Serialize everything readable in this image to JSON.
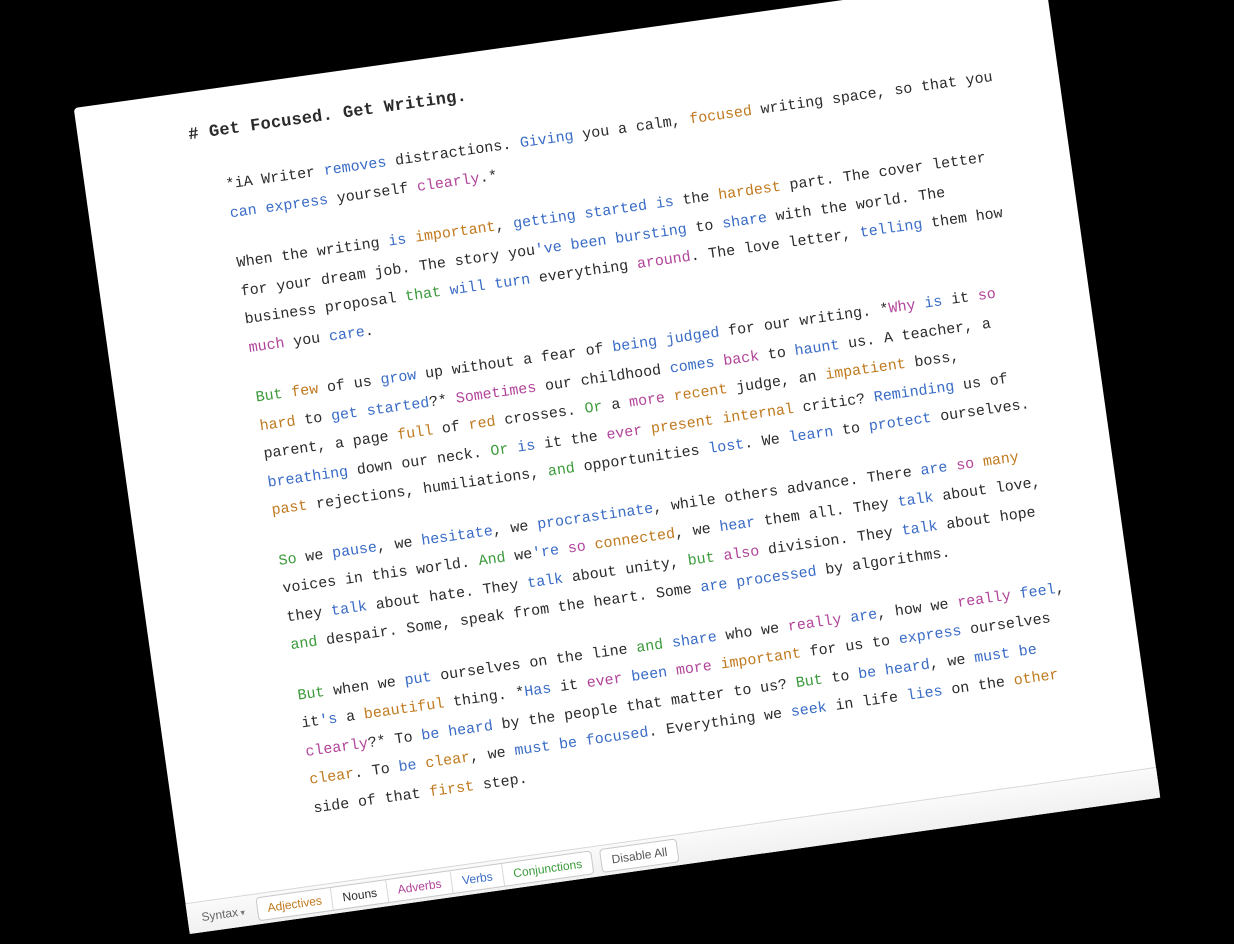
{
  "document": {
    "heading": "# Get Focused. Get Writing.",
    "p1": {
      "t1": "*iA Writer ",
      "removes": "removes",
      "t2": " distractions. ",
      "giving": "Giving",
      "t3": " you a calm, ",
      "focused": "focused",
      "t4": " writing space, so that you ",
      "can": "can",
      "t5": " ",
      "express": "express",
      "t6": " yourself ",
      "clearly": "clearly",
      "t7": ".*"
    },
    "p2": {
      "t1": "When the writing ",
      "is1": "is",
      "t2": " ",
      "important": "important",
      "t3": ", ",
      "getting": "getting",
      "t4": " ",
      "started": "started",
      "t5": " ",
      "is2": "is",
      "t6": " the ",
      "hardest": "hardest",
      "t7": " part. The cover letter for your dream job. The story you",
      "ve": "'ve",
      "t8": " ",
      "been": "been",
      "t9": " ",
      "bursting": "bursting",
      "t10": " to ",
      "share": "share",
      "t11": " with the world. The business proposal ",
      "that": "that",
      "t12": " ",
      "will": "will",
      "t13": " ",
      "turn": "turn",
      "t14": " everything ",
      "around": "around",
      "t15": ". The love letter, ",
      "telling": "telling",
      "t16": " them how ",
      "much": "much",
      "t17": " you ",
      "care": "care",
      "t18": "."
    },
    "p3": {
      "but1": "But",
      "t1": " ",
      "few": "few",
      "t2": " of us ",
      "grow": "grow",
      "t3": " up without a fear of ",
      "being": "being",
      "t4": " ",
      "judged": "judged",
      "t5": " for our writing. *",
      "why": "Why",
      "t6": " ",
      "is1": "is",
      "t7": " it ",
      "so": "so",
      "t8": " ",
      "hard": "hard",
      "t9": " to ",
      "get": "get",
      "t10": " ",
      "started": "started",
      "t11": "?* ",
      "sometimes": "Sometimes",
      "t12": " our childhood ",
      "comes": "comes",
      "t13": " ",
      "back": "back",
      "t14": " to ",
      "haunt": "haunt",
      "t15": " us. A teacher, a parent, a page ",
      "full": "full",
      "t16": " of ",
      "red": "red",
      "t17": " crosses. ",
      "or1": "Or",
      "t18": " a ",
      "more": "more",
      "t19": " ",
      "recent": "recent",
      "t20": " judge, an ",
      "impatient": "impatient",
      "t21": " boss, ",
      "breathing": "breathing",
      "t22": " down our neck. ",
      "or2": "Or",
      "t23": " ",
      "is2": "is",
      "t24": " it the ",
      "ever": "ever",
      "t25": " ",
      "present": "present",
      "t26": " ",
      "internal": "internal",
      "t27": " critic? ",
      "reminding": "Reminding",
      "t28": " us of ",
      "past": "past",
      "t29": " rejections, humiliations, ",
      "and": "and",
      "t30": " opportunities ",
      "lost": "lost",
      "t31": ". We ",
      "learn": "learn",
      "t32": " to ",
      "protect": "protect",
      "t33": " ourselves."
    },
    "p4": {
      "so": "So",
      "t1": " we ",
      "pause": "pause",
      "t2": ", we ",
      "hesitate": "hesitate",
      "t3": ", we ",
      "procrastinate": "procrastinate",
      "t4": ", while others advance. There ",
      "are1": "are",
      "t5": " ",
      "so2": "so",
      "t6": " ",
      "many": "many",
      "t7": " voices in this world. ",
      "and1": "And",
      "t8": " we",
      "re": "'re",
      "t9": " ",
      "so3": "so",
      "t10": " ",
      "connected": "connected",
      "t11": ", we ",
      "hear": "hear",
      "t12": " them all. They ",
      "talk1": "talk",
      "t13": " about love, they ",
      "talk2": "talk",
      "t14": " about hate. They ",
      "talk3": "talk",
      "t15": " about unity, ",
      "but2": "but",
      "t16": " ",
      "also": "also",
      "t17": " division. They ",
      "talk4": "talk",
      "t18": " about hope ",
      "and2": "and",
      "t19": " despair. Some, speak from the heart. Some ",
      "are2": "are",
      "t20": " ",
      "processed": "processed",
      "t21": " by algorithms."
    },
    "p5": {
      "but1": "But",
      "t1": " when we ",
      "put": "put",
      "t2": " ourselves on the line ",
      "and1": "and",
      "t3": " ",
      "share": "share",
      "t4": " who we ",
      "really1": "really",
      "t5": " ",
      "are": "are",
      "t6": ", how we ",
      "really2": "really",
      "t7": " ",
      "feel": "feel",
      "t8": ", it",
      "s": "'s",
      "t9": " a ",
      "beautiful": "beautiful",
      "t10": " thing. *",
      "has": "Has",
      "t11": " it ",
      "ever": "ever",
      "t12": " ",
      "been": "been",
      "t13": " ",
      "more": "more",
      "t14": " ",
      "important": "important",
      "t15": " for us to ",
      "express": "express",
      "t16": " ourselves ",
      "clearly": "clearly",
      "t17": "?* To ",
      "be1": "be",
      "t18": " ",
      "heard1": "heard",
      "t19": " by the people that matter to us? ",
      "but2": "But",
      "t20": " to ",
      "be2": "be",
      "t21": " ",
      "heard2": "heard",
      "t22": ", we ",
      "must1": "must",
      "t23": " ",
      "be3": "be",
      "t24": " ",
      "clear1": "clear",
      "t25": ". To ",
      "be4": "be",
      "t26": " ",
      "clear2": "clear",
      "t27": ", we ",
      "must2": "must",
      "t28": " ",
      "be5": "be",
      "t29": " ",
      "focused": "focused",
      "t30": ". Everything we ",
      "seek": "seek",
      "t31": " in life ",
      "lies": "lies",
      "t32": " on the ",
      "other": "other",
      "t33": " side of that ",
      "first": "first",
      "t34": " step."
    }
  },
  "toolbar": {
    "syntax_label": "Syntax",
    "adjectives": "Adjectives",
    "nouns": "Nouns",
    "adverbs": "Adverbs",
    "verbs": "Verbs",
    "conjunctions": "Conjunctions",
    "disable_all": "Disable All"
  },
  "colors": {
    "adjective": "#c07a1f",
    "noun": "#2b2b2b",
    "adverb": "#b2459a",
    "verb": "#3a6cc6",
    "conjunction": "#3c9a3c"
  }
}
